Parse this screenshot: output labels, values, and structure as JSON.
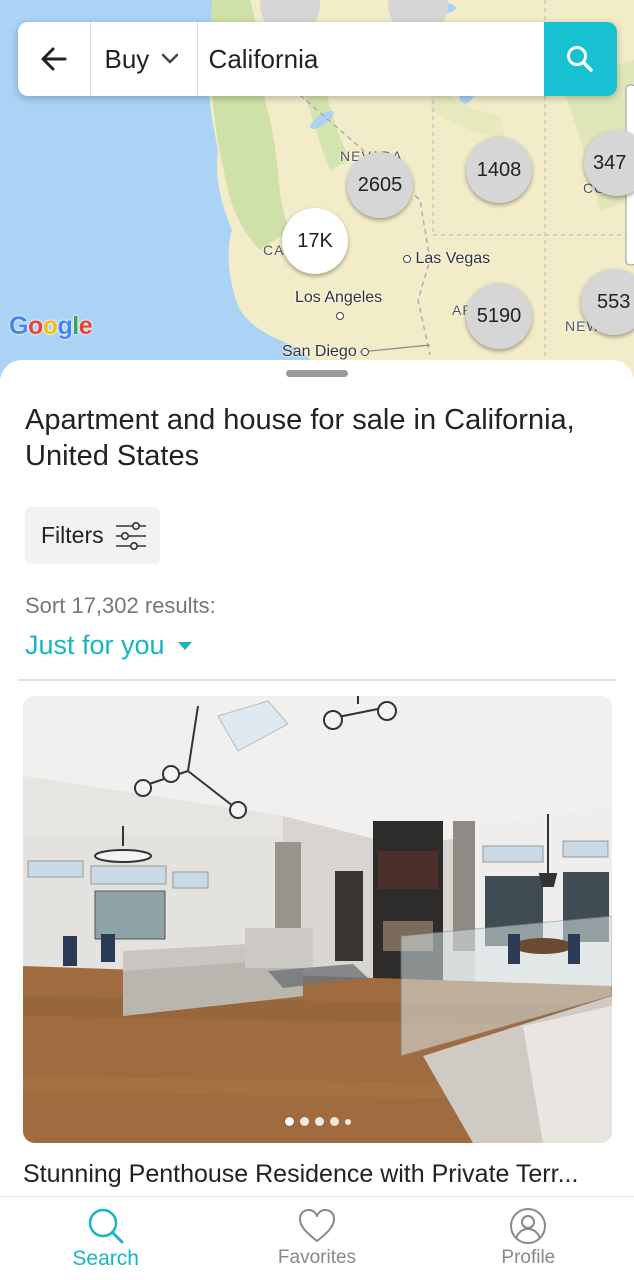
{
  "search_bar": {
    "back_icon": "arrow-left-icon",
    "listing_type": "Buy",
    "location": "California",
    "search_icon": "search-icon",
    "accent": "#17c1d1"
  },
  "map": {
    "labels": {
      "nevada": "NEVADA",
      "california": "CA",
      "las_vegas": "Las Vegas",
      "los_angeles": "Los Angeles",
      "san_diego": "San Diego",
      "arizona": "AR",
      "new_mexico": "NEW",
      "colorado": "CO"
    },
    "clusters": [
      "2605",
      "1408",
      "347",
      "17K",
      "5190",
      "553"
    ],
    "attribution": [
      "G",
      "o",
      "o",
      "g",
      "l",
      "e"
    ]
  },
  "results": {
    "title": "Apartment and house for sale in California, United States",
    "filters_label": "Filters",
    "sort_count": "Sort 17,302 results:",
    "sort_option": "Just for you"
  },
  "listing": {
    "title": "Stunning Penthouse Residence with Private Terr...",
    "photo_dots": 5,
    "active_dot": 1
  },
  "nav": {
    "search": "Search",
    "favorites": "Favorites",
    "profile": "Profile",
    "active_color": "#17b5c4"
  }
}
